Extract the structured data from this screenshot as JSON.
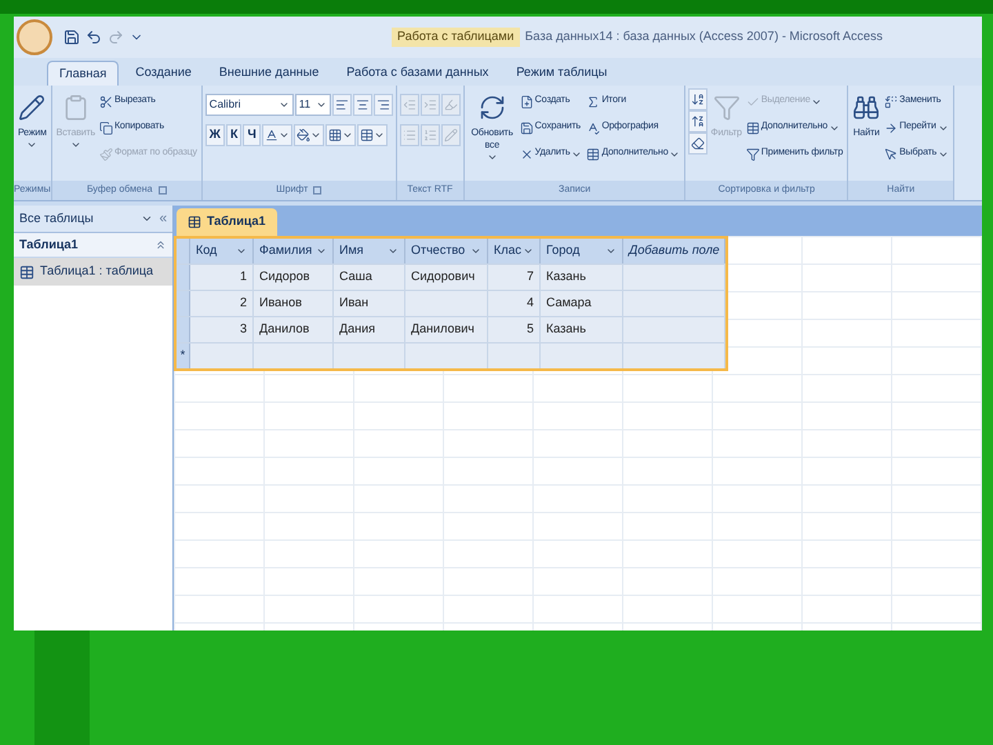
{
  "window": {
    "title": "База данных14 : база данных (Access 2007) - Microsoft Access",
    "context_tab": "Работа с таблицами"
  },
  "tabs": [
    {
      "label": "Главная",
      "selected": true
    },
    {
      "label": "Создание",
      "selected": false
    },
    {
      "label": "Внешние данные",
      "selected": false
    },
    {
      "label": "Работа с базами данных",
      "selected": false
    },
    {
      "label": "Режим таблицы",
      "selected": false
    }
  ],
  "ribbon": [
    {
      "label": "Режимы",
      "launcher": false,
      "columns": [
        [
          {
            "kind": "large",
            "label": "Режим",
            "disabled": false,
            "dropdown": true
          }
        ]
      ]
    },
    {
      "label": "Буфер обмена",
      "launcher": true,
      "columns": [
        [
          {
            "kind": "large",
            "label": "Вставить",
            "disabled": true,
            "dropdown": true
          }
        ],
        [
          {
            "kind": "small",
            "label": "Вырезать",
            "disabled": false,
            "dropdown": false
          },
          {
            "kind": "small",
            "label": "Копировать",
            "disabled": false,
            "dropdown": false
          },
          {
            "kind": "small",
            "label": "Формат по образцу",
            "disabled": true,
            "dropdown": false
          }
        ]
      ]
    },
    {
      "label": "Шрифт",
      "launcher": true,
      "strips": [
        [
          {
            "kind": "combo",
            "value": "Calibri",
            "disabled": false,
            "dropdown": true
          },
          {
            "kind": "combo",
            "value": "11",
            "disabled": false,
            "dropdown": true
          },
          {
            "kind": "icon",
            "disabled": false,
            "dropdown": false
          },
          {
            "kind": "icon",
            "disabled": false,
            "dropdown": false
          },
          {
            "kind": "icon",
            "disabled": false,
            "dropdown": false
          }
        ],
        [
          {
            "kind": "letter",
            "label": "Ж",
            "disabled": false,
            "dropdown": false
          },
          {
            "kind": "letter",
            "label": "К",
            "disabled": false,
            "dropdown": false
          },
          {
            "kind": "letter",
            "label": "Ч",
            "disabled": false,
            "dropdown": false
          },
          {
            "kind": "icon",
            "disabled": false,
            "dropdown": true
          },
          {
            "kind": "icon",
            "disabled": false,
            "dropdown": true
          },
          {
            "kind": "icon",
            "disabled": false,
            "dropdown": true
          },
          {
            "kind": "icon",
            "disabled": false,
            "dropdown": true
          }
        ]
      ]
    },
    {
      "label": "Текст RTF",
      "launcher": false,
      "strips": [
        [
          {
            "kind": "icon",
            "disabled": true,
            "dropdown": false
          },
          {
            "kind": "icon",
            "disabled": true,
            "dropdown": false
          },
          {
            "kind": "icon",
            "disabled": true,
            "dropdown": false
          }
        ],
        [
          {
            "kind": "icon",
            "disabled": true,
            "dropdown": false
          },
          {
            "kind": "icon",
            "disabled": true,
            "dropdown": false
          },
          {
            "kind": "icon",
            "disabled": true,
            "dropdown": false
          }
        ]
      ]
    },
    {
      "label": "Записи",
      "launcher": false,
      "columns": [
        [
          {
            "kind": "large",
            "label": "Обновить все",
            "disabled": false,
            "dropdown": true
          }
        ],
        [
          {
            "kind": "small",
            "label": "Создать",
            "disabled": false,
            "dropdown": false
          },
          {
            "kind": "small",
            "label": "Сохранить",
            "disabled": false,
            "dropdown": false
          },
          {
            "kind": "small",
            "label": "Удалить",
            "disabled": false,
            "dropdown": true
          }
        ],
        [
          {
            "kind": "small",
            "label": "Итоги",
            "disabled": false,
            "dropdown": false
          },
          {
            "kind": "small",
            "label": "Орфография",
            "disabled": false,
            "dropdown": false
          },
          {
            "kind": "small",
            "label": "Дополнительно",
            "disabled": false,
            "dropdown": true
          }
        ]
      ]
    },
    {
      "label": "Сортировка и фильтр",
      "launcher": false,
      "columns": [
        [
          {
            "kind": "icon",
            "disabled": false,
            "dropdown": false
          },
          {
            "kind": "icon",
            "disabled": false,
            "dropdown": false
          },
          {
            "kind": "icon",
            "disabled": false,
            "dropdown": false
          }
        ],
        [
          {
            "kind": "large",
            "label": "Фильтр",
            "disabled": true,
            "dropdown": false
          }
        ],
        [
          {
            "kind": "small",
            "label": "Выделение",
            "disabled": true,
            "dropdown": true
          },
          {
            "kind": "small",
            "label": "Дополнительно",
            "disabled": false,
            "dropdown": true
          },
          {
            "kind": "small",
            "label": "Применить фильтр",
            "disabled": false,
            "dropdown": false
          }
        ]
      ]
    },
    {
      "label": "Найти",
      "launcher": false,
      "columns": [
        [
          {
            "kind": "large",
            "label": "Найти",
            "disabled": false,
            "dropdown": false
          }
        ],
        [
          {
            "kind": "small",
            "label": "Заменить",
            "disabled": false,
            "dropdown": false
          },
          {
            "kind": "small",
            "label": "Перейти",
            "disabled": false,
            "dropdown": true
          },
          {
            "kind": "small",
            "label": "Выбрать",
            "disabled": false,
            "dropdown": true
          }
        ]
      ]
    }
  ],
  "nav": {
    "header": "Все таблицы",
    "collapse": "«",
    "groups": [
      {
        "label": "Таблица1",
        "expanded": true,
        "items": [
          {
            "label": "Таблица1 : таблица",
            "selected": true
          }
        ]
      }
    ]
  },
  "document": {
    "tabs": [
      {
        "label": "Таблица1",
        "selected": true
      }
    ],
    "table": {
      "columns": [
        {
          "label": "Код",
          "kind": "field"
        },
        {
          "label": "Фамилия",
          "kind": "field"
        },
        {
          "label": "Имя",
          "kind": "field"
        },
        {
          "label": "Отчество",
          "kind": "field"
        },
        {
          "label": "Клас",
          "kind": "field"
        },
        {
          "label": "Город",
          "kind": "field"
        },
        {
          "label": "Добавить поле",
          "kind": "add"
        }
      ],
      "rows": [
        [
          "1",
          "Сидоров",
          "Саша",
          "Сидорович",
          "7",
          "Казань"
        ],
        [
          "2",
          "Иванов",
          "Иван",
          "",
          "4",
          "Самара"
        ],
        [
          "3",
          "Данилов",
          "Дания",
          "Данилович",
          "5",
          "Казань"
        ]
      ],
      "new_row_marker": "*"
    }
  }
}
